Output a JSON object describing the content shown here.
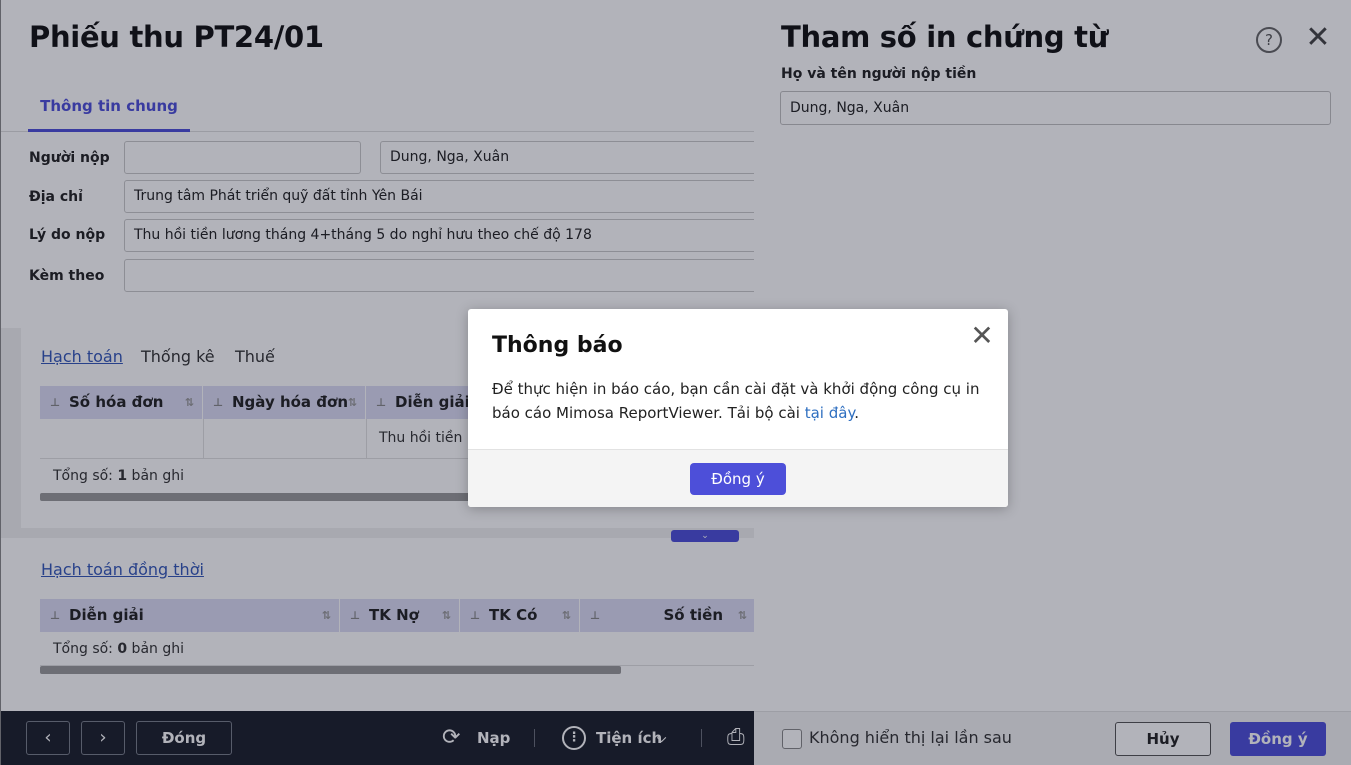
{
  "form": {
    "title": "Phiếu thu PT24/01",
    "tab": "Thông tin chung",
    "fields": {
      "payer_label": "Người nộp",
      "payer_select": "",
      "payer_name": "Dung, Nga, Xuân",
      "address_label": "Địa chỉ",
      "address_value": "Trung tâm Phát triển quỹ đất tỉnh Yên Bái",
      "reason_label": "Lý do nộp",
      "reason_value": "Thu hồi tiền lương tháng 4+tháng 5 do nghỉ hưu theo chế độ 178",
      "attach_label": "Kèm theo",
      "attach_value": ""
    },
    "subtabs": [
      "Hạch toán",
      "Thống kê",
      "Thuế"
    ],
    "grid1": {
      "columns": [
        "Số hóa đơn",
        "Ngày hóa đơn",
        "Diễn giải"
      ],
      "row_desc": "Thu hồi tiền l",
      "total_prefix": "Tổng số: ",
      "total_count": "1",
      "total_suffix": " bản ghi"
    },
    "section2_title": "Hạch toán đồng thời",
    "grid2": {
      "columns": [
        "Diễn giải",
        "TK Nợ",
        "TK Có",
        "Số tiền"
      ],
      "total_prefix": "Tổng số: ",
      "total_count": "0",
      "total_suffix": " bản ghi"
    },
    "footer": {
      "close_label": "Đóng",
      "reload_label": "Nạp",
      "utility_label": "Tiện ích"
    }
  },
  "panel": {
    "title": "Tham số in chứng từ",
    "field_label": "Họ và tên người nộp tiền",
    "field_value": "Dung, Nga, Xuân",
    "checkbox_label": "Không hiển thị lại lần sau",
    "cancel_label": "Hủy",
    "ok_label": "Đồng ý"
  },
  "dialog": {
    "title": "Thông báo",
    "message_main": "Để thực hiện in báo cáo, bạn cần cài đặt và khởi động công cụ in báo cáo Mimosa ReportViewer. Tải bộ cài ",
    "message_link": "tại đây",
    "message_end": ".",
    "ok_label": "Đồng ý"
  },
  "colors": {
    "accent": "#4d4fd9",
    "footer_bg": "#1b1f2a",
    "link": "#2f6fc0"
  }
}
